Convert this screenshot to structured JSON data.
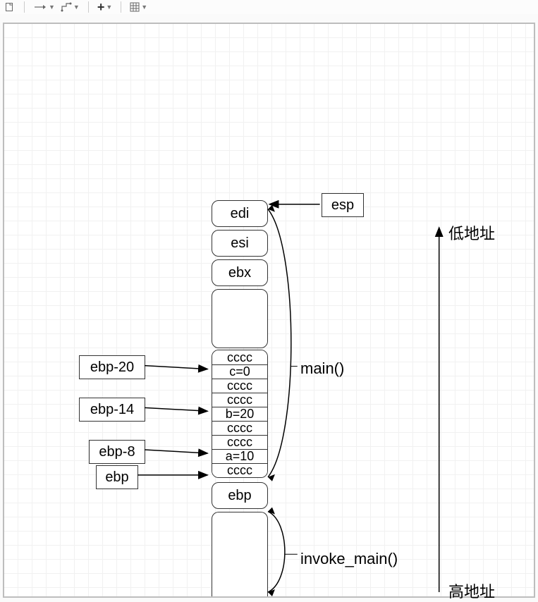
{
  "toolbar": {
    "icons": {
      "page": "page-icon",
      "arrow": "arrow-icon",
      "connector": "connector-icon",
      "add": "add-icon",
      "grid": "grid-icon"
    }
  },
  "esp_label": "esp",
  "stack": {
    "edi": "edi",
    "esi": "esi",
    "ebx": "ebx",
    "slots": [
      "cccc",
      "c=0",
      "cccc",
      "cccc",
      "b=20",
      "cccc",
      "cccc",
      "a=10",
      "cccc"
    ],
    "ebp_cell": "ebp"
  },
  "pointers": {
    "ebp20": "ebp-20",
    "ebp14": "ebp-14",
    "ebp8": "ebp-8",
    "ebp": "ebp"
  },
  "annotations": {
    "main": "main()",
    "invoke": "invoke_main()",
    "low": "低地址",
    "high": "高地址"
  }
}
